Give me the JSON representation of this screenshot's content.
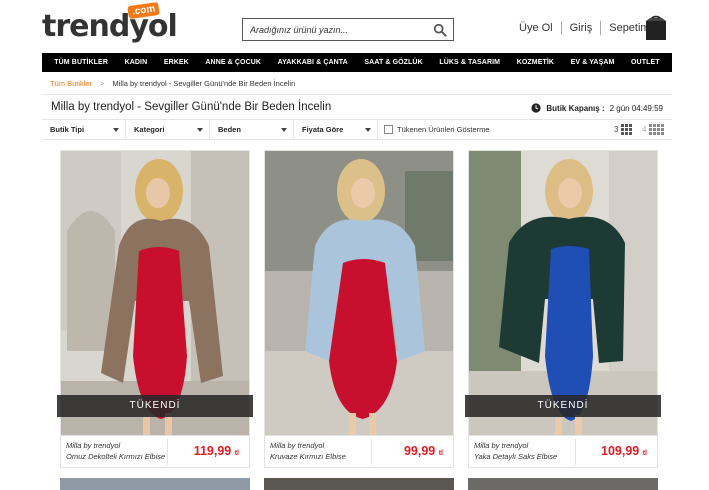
{
  "header": {
    "logo_text": "trendyol",
    "logo_badge": ".com",
    "search_placeholder": "Aradığınız ürünü yazın...",
    "links": {
      "register": "Üye Ol",
      "login": "Giriş",
      "cart": "Sepetim"
    }
  },
  "nav": {
    "items": [
      "TÜM BUTİKLER",
      "KADIN",
      "ERKEK",
      "ANNE & ÇOCUK",
      "AYAKKABI & ÇANTA",
      "SAAT & GÖZLÜK",
      "LÜKS & TASARIM",
      "KOZMETİK",
      "EV & YAŞAM",
      "OUTLET"
    ]
  },
  "breadcrumb": {
    "root": "Tüm Butikler",
    "separator": ">",
    "current": "Milla by trendyol - Sevgiller Günü'nde Bir Beden İncelin"
  },
  "page": {
    "title": "Milla by trendyol - Sevgiller Günü'nde Bir Beden İncelin",
    "timer_label": "Butik Kapanış :",
    "timer_value": "2 gün 04:49:59"
  },
  "filters": {
    "butik_tipi": "Butik Tipi",
    "kategori": "Kategori",
    "beden": "Beden",
    "fiyat": "Fiyata Göre",
    "show_soldout": "Tükenen Ürünleri Gösterme",
    "grid3_label": "3",
    "grid4_label": "4"
  },
  "products": [
    {
      "brand": "Milla by trendyol",
      "name": "Omuz Dekolteli Kırmızı Elbise",
      "price": "119,99",
      "currency": "tl",
      "status": "TÜKENDİ",
      "dress_color": "#c8102e",
      "coat_color": "#8b7360"
    },
    {
      "brand": "Milla by trendyol",
      "name": "Kruvaze Kırmızı Elbise",
      "price": "99,99",
      "currency": "tl",
      "status": "",
      "dress_color": "#c8102e",
      "coat_color": "#aac4dc"
    },
    {
      "brand": "Milla by trendyol",
      "name": "Yaka Detaylı Saks Elbise",
      "price": "109,99",
      "currency": "tl",
      "status": "TÜKENDİ",
      "dress_color": "#1f4fb4",
      "coat_color": "#1e3a35"
    }
  ],
  "colors": {
    "accent": "#f27a1a",
    "price": "#e11b22",
    "nav_bg": "#000000"
  }
}
